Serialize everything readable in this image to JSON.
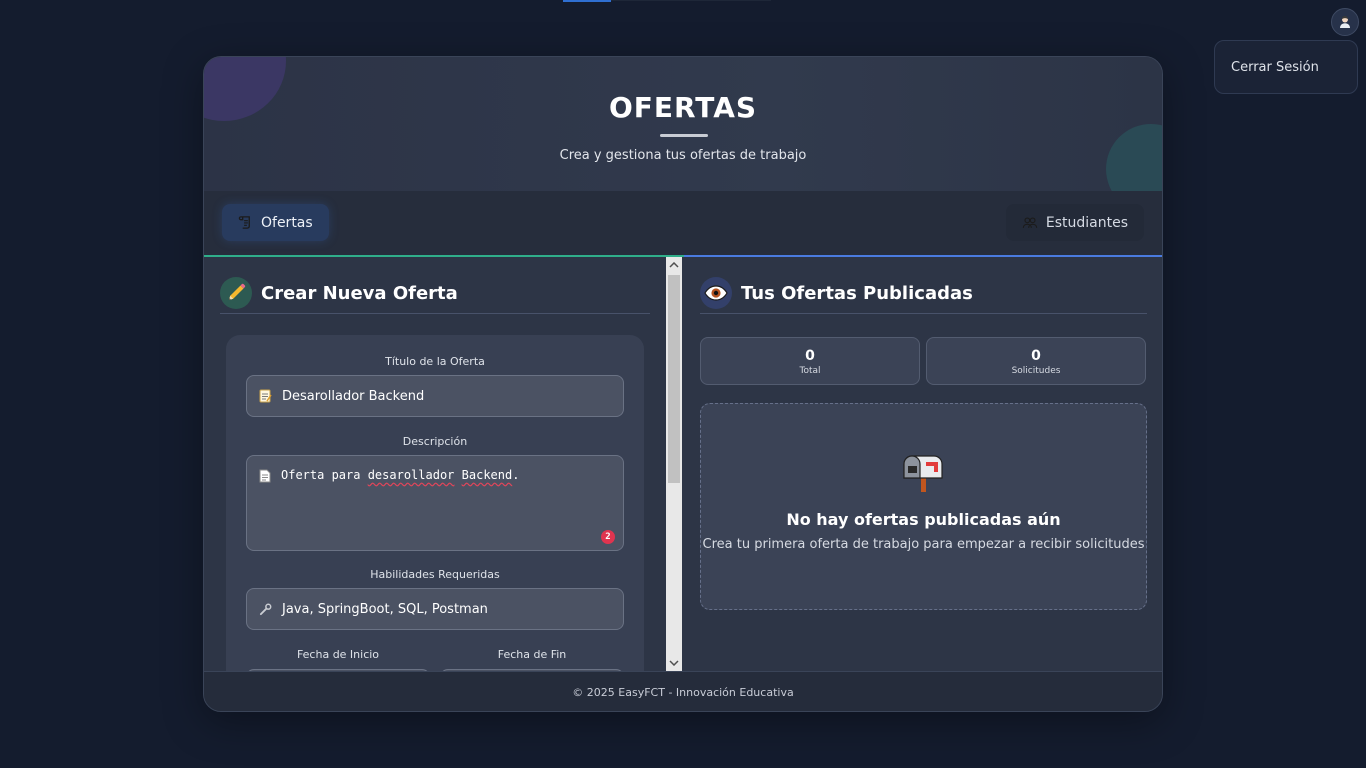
{
  "user_menu": {
    "avatar_icon": "user-avatar-icon",
    "logout_label": "Cerrar Sesión"
  },
  "header": {
    "title": "OFERTAS",
    "subtitle": "Crea y gestiona tus ofertas de trabajo"
  },
  "nav": {
    "ofertas_label": "Ofertas",
    "ofertas_icon": "scroll-icon",
    "estudiantes_label": "Estudiantes",
    "estudiantes_icon": "users-icon"
  },
  "create": {
    "title": "Crear Nueva Oferta",
    "icon": "pencil-icon",
    "fields": {
      "titulo_label": "Título de la Oferta",
      "titulo_value": "Desarollador Backend",
      "descripcion_label": "Descripción",
      "descripcion_value_prefix": "Oferta para ",
      "descripcion_word1": "desarollador",
      "descripcion_space": " ",
      "descripcion_word2": "Backend",
      "descripcion_suffix": ".",
      "spell_error_count": "2",
      "habilidades_label": "Habilidades Requeridas",
      "habilidades_value": "Java, SpringBoot, SQL, Postman",
      "fecha_inicio_label": "Fecha de Inicio",
      "fecha_fin_label": "Fecha de Fin"
    }
  },
  "published": {
    "title": "Tus Ofertas Publicadas",
    "icon": "eye-icon",
    "stats": [
      {
        "value": "0",
        "label": "Total"
      },
      {
        "value": "0",
        "label": "Solicitudes"
      }
    ],
    "empty_icon": "mailbox-icon",
    "empty_title": "No hay ofertas publicadas aún",
    "empty_subtitle": "Crea tu primera oferta de trabajo para empezar a recibir solicitudes"
  },
  "footer": {
    "text": "© 2025 EasyFCT - Innovación Educativa"
  },
  "colors": {
    "background": "#141c2e",
    "card": "#2b3344",
    "accent_green": "#2fae8a",
    "accent_blue": "#4a7be0",
    "nav_active": "#283b5e"
  }
}
